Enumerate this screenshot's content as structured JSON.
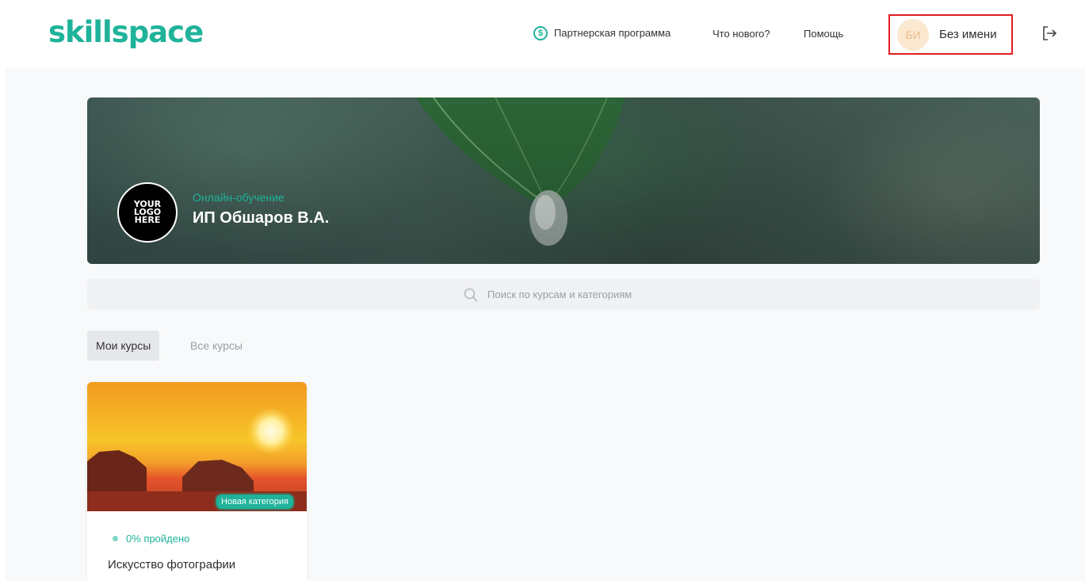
{
  "header": {
    "logo_text": "skillspace",
    "nav": {
      "partner": "Партнерская программа",
      "whats_new": "Что нового?",
      "help": "Помощь"
    },
    "user": {
      "initials": "БИ",
      "name": "Без имени"
    },
    "accent_color": "#1fb39a",
    "highlight_color": "#e01e1e"
  },
  "hero": {
    "logo_lines": [
      "YOUR",
      "LOGO",
      "HERE"
    ],
    "subtitle": "Онлайн-обучение",
    "title": "ИП Обшаров В.А."
  },
  "search": {
    "placeholder": "Поиск по курсам и категориям"
  },
  "tabs": [
    {
      "label": "Мои курсы",
      "active": true
    },
    {
      "label": "Все курсы",
      "active": false
    }
  ],
  "courses": [
    {
      "category": "Новая категория",
      "progress": "0% пройдено",
      "title": "Искусство фотографии"
    }
  ],
  "icons": {
    "dollar": "dollar-circle-icon",
    "logout": "logout-icon",
    "search": "search-icon"
  }
}
